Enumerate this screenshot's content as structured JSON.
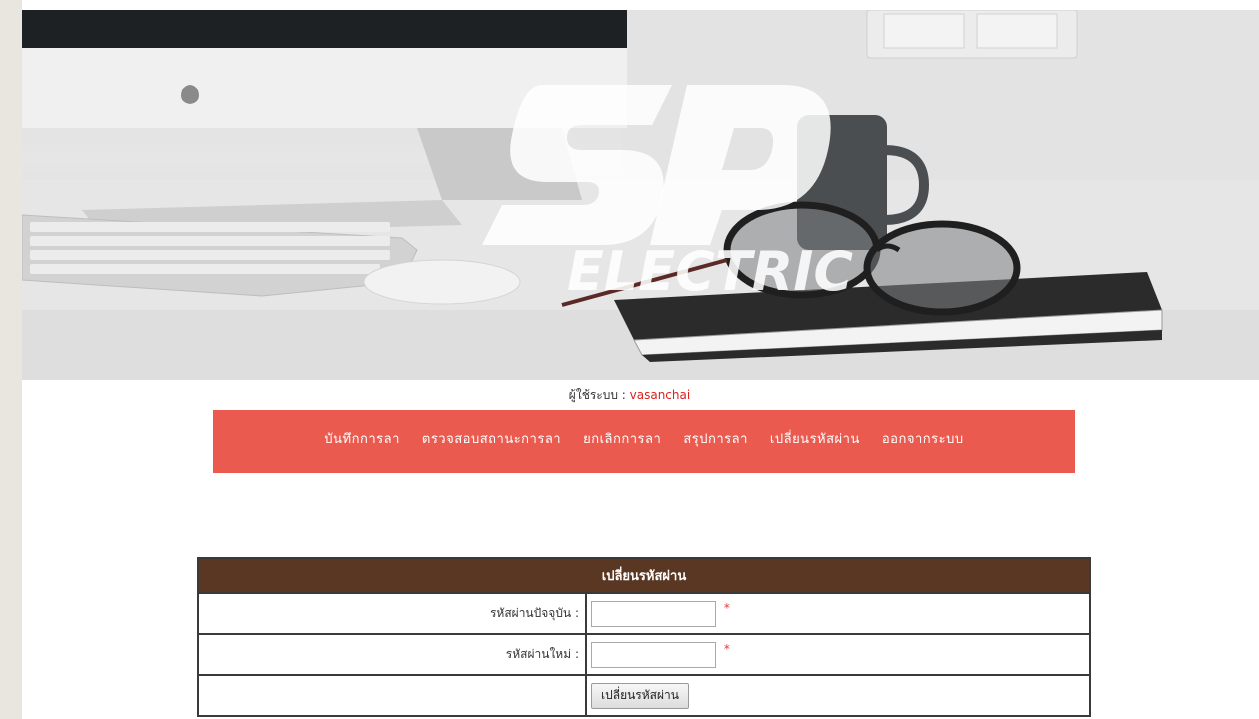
{
  "banner": {
    "logo_letters": "SP",
    "logo_word": "ELECTRIC"
  },
  "user": {
    "label": "ผู้ใช้ระบบ : ",
    "name": "vasanchai"
  },
  "nav": {
    "items": [
      {
        "label": "บันทึกการลา"
      },
      {
        "label": "ตรวจสอบสถานะการลา"
      },
      {
        "label": "ยกเลิกการลา"
      },
      {
        "label": "สรุปการลา"
      },
      {
        "label": "เปลี่ยนรหัสผ่าน"
      },
      {
        "label": "ออกจากระบบ"
      }
    ]
  },
  "form": {
    "title": "เปลี่ยนรหัสผ่าน",
    "current_password_label": "รหัสผ่านปัจจุบัน :",
    "current_password_value": "",
    "new_password_label": "รหัสผ่านใหม่ :",
    "new_password_value": "",
    "required_mark": "*",
    "submit_label": "เปลี่ยนรหัสผ่าน"
  },
  "colors": {
    "nav_bg": "#ea5a4f",
    "table_header_bg": "#5a3722",
    "username": "#d9231f",
    "required": "#e23b3b"
  }
}
